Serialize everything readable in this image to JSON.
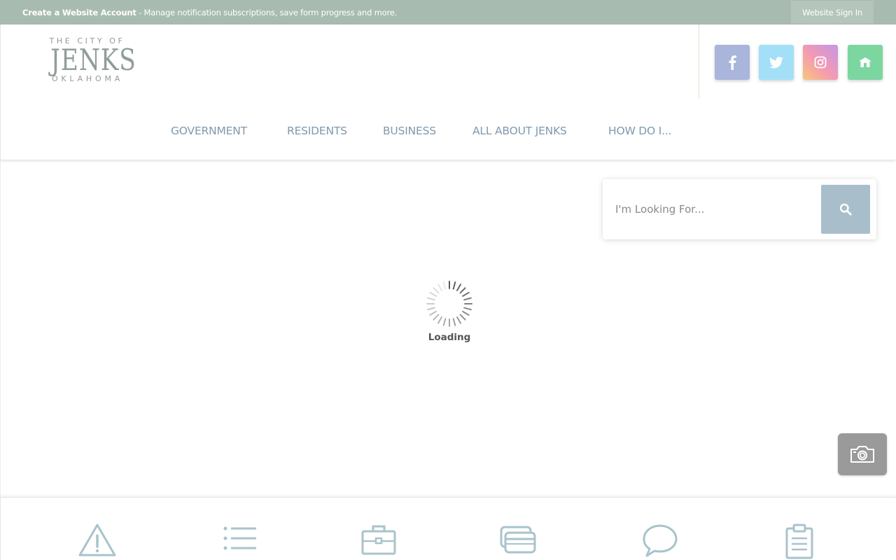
{
  "top_bar": {
    "account_link": "Create a Website Account",
    "account_desc": " - Manage notification subscriptions, save form progress and more.",
    "sign_in": "Website Sign In",
    "bg_color": "#a8bbb0"
  },
  "logo": {
    "line1": "THE CITY OF",
    "line2": "JENKS",
    "line3": "OKLAHOMA"
  },
  "social": [
    {
      "name": "facebook",
      "icon": "facebook-icon",
      "color": "#a9b5da"
    },
    {
      "name": "twitter",
      "icon": "twitter-icon",
      "color": "#a3e0f8"
    },
    {
      "name": "instagram",
      "icon": "instagram-icon",
      "color": "#f59ab0"
    },
    {
      "name": "home",
      "icon": "home-icon",
      "color": "#7cd6a0"
    }
  ],
  "nav": {
    "items": [
      "GOVERNMENT",
      "RESIDENTS",
      "BUSINESS",
      "ALL ABOUT JENKS",
      "HOW DO I..."
    ],
    "color": "#8099ad"
  },
  "search": {
    "placeholder": "I'm Looking For...",
    "button_color": "#a8bfcb"
  },
  "loading": {
    "text": "Loading"
  },
  "camera_button": {
    "icon": "camera-icon"
  },
  "footer_icons": [
    {
      "icon": "alert-icon"
    },
    {
      "icon": "list-icon"
    },
    {
      "icon": "briefcase-icon"
    },
    {
      "icon": "credit-card-icon"
    },
    {
      "icon": "chat-bubble-icon"
    },
    {
      "icon": "clipboard-icon"
    }
  ]
}
